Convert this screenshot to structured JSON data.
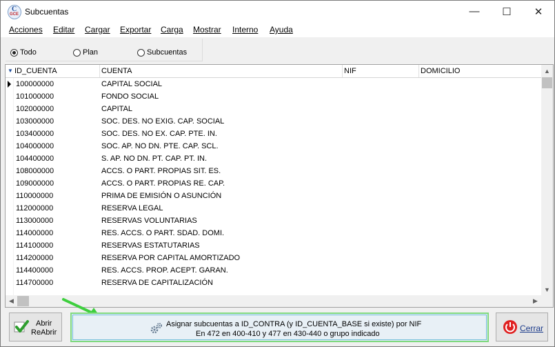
{
  "window": {
    "title": "Subcuentas",
    "app_icon_letter": "C",
    "app_icon_sub": "GCE"
  },
  "titlebar_buttons": {
    "minimize": "—",
    "maximize": "☐",
    "close": "✕"
  },
  "menu": [
    "Acciones",
    "Editar",
    "Cargar",
    "Exportar",
    "Carga",
    "Mostrar",
    "Interno",
    "Ayuda"
  ],
  "filter": {
    "options": [
      "Todo",
      "Plan",
      "Subcuentas"
    ],
    "selected": "Todo"
  },
  "grid": {
    "columns": [
      "ID_CUENTA",
      "CUENTA",
      "NIF",
      "DOMICILIO"
    ],
    "rows": [
      {
        "id": "100000000",
        "name": "CAPITAL SOCIAL"
      },
      {
        "id": "101000000",
        "name": "FONDO SOCIAL"
      },
      {
        "id": "102000000",
        "name": "CAPITAL"
      },
      {
        "id": "103000000",
        "name": "SOC. DES. NO EXIG. CAP. SOCIAL"
      },
      {
        "id": "103400000",
        "name": "SOC. DES. NO EX. CAP. PTE. IN."
      },
      {
        "id": "104000000",
        "name": "SOC. AP. NO DN. PTE. CAP. SCL."
      },
      {
        "id": "104400000",
        "name": "S. AP. NO DN. PT. CAP. PT. IN."
      },
      {
        "id": "108000000",
        "name": "ACCS. O PART. PROPIAS SIT. ES."
      },
      {
        "id": "109000000",
        "name": "ACCS. O PART. PROPIAS RE. CAP."
      },
      {
        "id": "110000000",
        "name": "PRIMA DE EMISIÓN O ASUNCIÓN"
      },
      {
        "id": "112000000",
        "name": "RESERVA LEGAL"
      },
      {
        "id": "113000000",
        "name": "RESERVAS VOLUNTARIAS"
      },
      {
        "id": "114000000",
        "name": "RES. ACCS. O PART. SDAD. DOMI."
      },
      {
        "id": "114100000",
        "name": "RESERVAS ESTATUTARIAS"
      },
      {
        "id": "114200000",
        "name": "RESERVA POR CAPITAL AMORTIZADO"
      },
      {
        "id": "114400000",
        "name": "RES. ACCS. PROP. ACEPT. GARAN."
      },
      {
        "id": "114700000",
        "name": "RESERVA DE CAPITALIZACIÓN"
      }
    ]
  },
  "buttons": {
    "abrir_line1": "Abrir",
    "abrir_line2": "ReAbrir",
    "assign_line1": "Asignar subcuentas a ID_CONTRA (y ID_CUENTA_BASE si existe) por NIF",
    "assign_line2": "En 472 en 400-410 y 477 en 430-440 o grupo indicado",
    "cerrar": "Cerrar"
  },
  "colors": {
    "highlight_arrow": "#3ecf3e",
    "focus_border": "#7fd97f"
  }
}
